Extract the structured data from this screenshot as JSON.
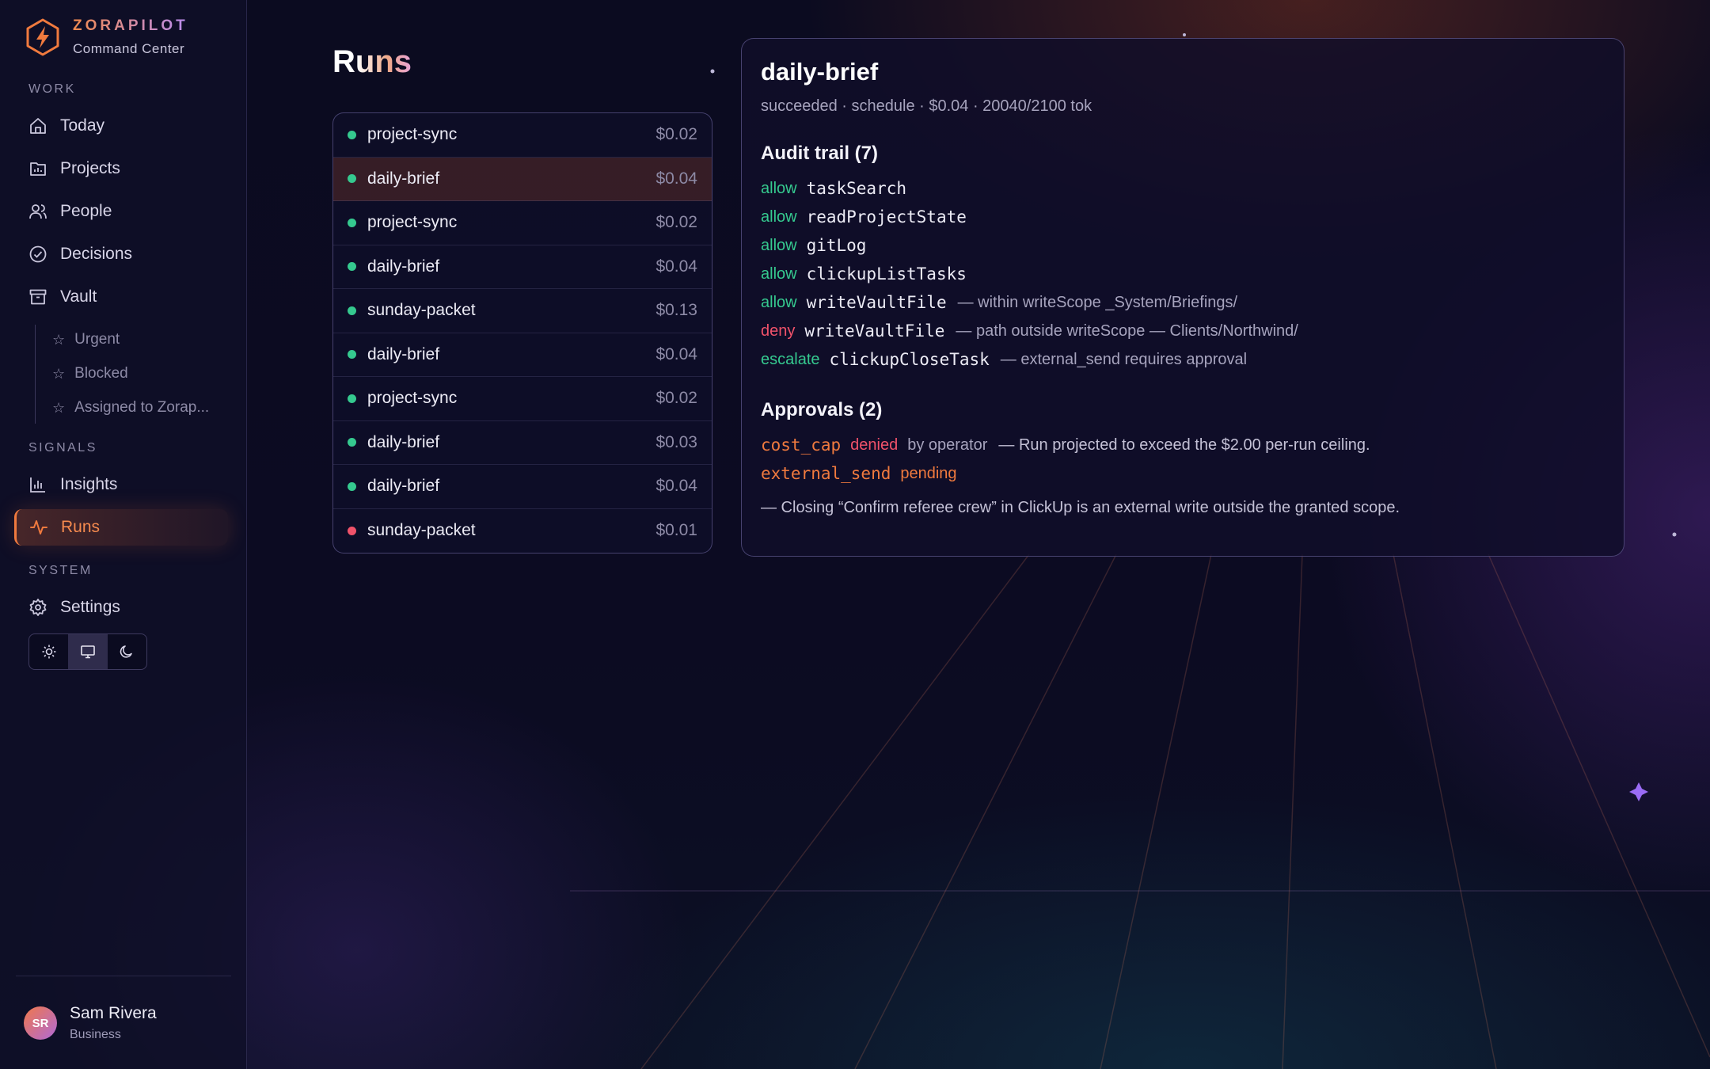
{
  "brand": {
    "name": "ZORAPILOT",
    "subtitle": "Command Center"
  },
  "sidebar": {
    "sections": {
      "work": "WORK",
      "signals": "SIGNALS",
      "system": "SYSTEM"
    },
    "items": {
      "today": "Today",
      "projects": "Projects",
      "people": "People",
      "decisions": "Decisions",
      "vault": "Vault",
      "insights": "Insights",
      "runs": "Runs",
      "settings": "Settings"
    },
    "vault_subitems": [
      "Urgent",
      "Blocked",
      "Assigned to Zorap..."
    ],
    "theme_options": [
      "light",
      "system",
      "dark"
    ],
    "theme_selected": "system"
  },
  "user": {
    "initials": "SR",
    "name": "Sam Rivera",
    "plan": "Business"
  },
  "page": {
    "title": "Runs"
  },
  "runs": [
    {
      "name": "project-sync",
      "cost": "$0.02",
      "status": "success"
    },
    {
      "name": "daily-brief",
      "cost": "$0.04",
      "status": "success",
      "selected": true
    },
    {
      "name": "project-sync",
      "cost": "$0.02",
      "status": "success"
    },
    {
      "name": "daily-brief",
      "cost": "$0.04",
      "status": "success"
    },
    {
      "name": "sunday-packet",
      "cost": "$0.13",
      "status": "success"
    },
    {
      "name": "daily-brief",
      "cost": "$0.04",
      "status": "success"
    },
    {
      "name": "project-sync",
      "cost": "$0.02",
      "status": "success"
    },
    {
      "name": "daily-brief",
      "cost": "$0.03",
      "status": "success"
    },
    {
      "name": "daily-brief",
      "cost": "$0.04",
      "status": "success"
    },
    {
      "name": "sunday-packet",
      "cost": "$0.01",
      "status": "failed"
    }
  ],
  "detail": {
    "title": "daily-brief",
    "meta": "succeeded · schedule · $0.04 · 20040/2100 tok",
    "audit_heading": "Audit trail (7)",
    "audit": [
      {
        "verdict": "allow",
        "tool": "taskSearch",
        "note": ""
      },
      {
        "verdict": "allow",
        "tool": "readProjectState",
        "note": ""
      },
      {
        "verdict": "allow",
        "tool": "gitLog",
        "note": ""
      },
      {
        "verdict": "allow",
        "tool": "clickupListTasks",
        "note": ""
      },
      {
        "verdict": "allow",
        "tool": "writeVaultFile",
        "note": "— within writeScope _System/Briefings/"
      },
      {
        "verdict": "deny",
        "tool": "writeVaultFile",
        "note": "— path outside writeScope — Clients/Northwind/"
      },
      {
        "verdict": "escalate",
        "tool": "clickupCloseTask",
        "note": "— external_send requires approval"
      }
    ],
    "approvals_heading": "Approvals (2)",
    "approvals": [
      {
        "key": "cost_cap",
        "status": "denied",
        "by": "by operator",
        "reason": "— Run projected to exceed the $2.00 per-run ceiling."
      },
      {
        "key": "external_send",
        "status": "pending",
        "by": "",
        "reason": ""
      }
    ],
    "approval_note": "— Closing “Confirm referee crew” in ClickUp is an external write outside the granted scope."
  },
  "colors": {
    "accent": "#f07a3e",
    "success": "#35c98f",
    "danger": "#f0526a",
    "background": "#0a0a1e"
  }
}
